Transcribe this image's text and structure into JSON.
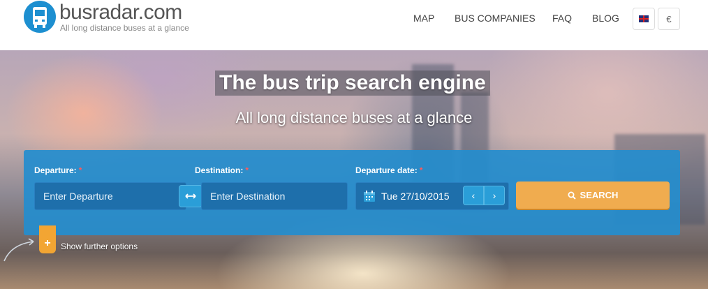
{
  "header": {
    "brand": "busradar.com",
    "tagline": "All long distance buses at a glance",
    "nav": [
      "MAP",
      "BUS COMPANIES",
      "FAQ",
      "BLOG"
    ],
    "currency": "€",
    "language_icon": "uk-flag-icon"
  },
  "hero": {
    "headline": "The bus trip search engine",
    "subline": "All long distance buses at a glance"
  },
  "search": {
    "departure_label": "Departure:",
    "destination_label": "Destination:",
    "date_label": "Departure date:",
    "required_mark": "*",
    "departure_placeholder": "Enter Departure",
    "destination_placeholder": "Enter Destination",
    "date_value": "Tue 27/10/2015",
    "prev": "‹",
    "next": "›",
    "button_label": "SEARCH",
    "more_options": "Show further options",
    "more_icon": "+"
  },
  "colors": {
    "brand_blue": "#1d8fd0",
    "panel_blue": "#258dce",
    "search_orange": "#f0ac4f",
    "tab_orange": "#f2a533"
  }
}
